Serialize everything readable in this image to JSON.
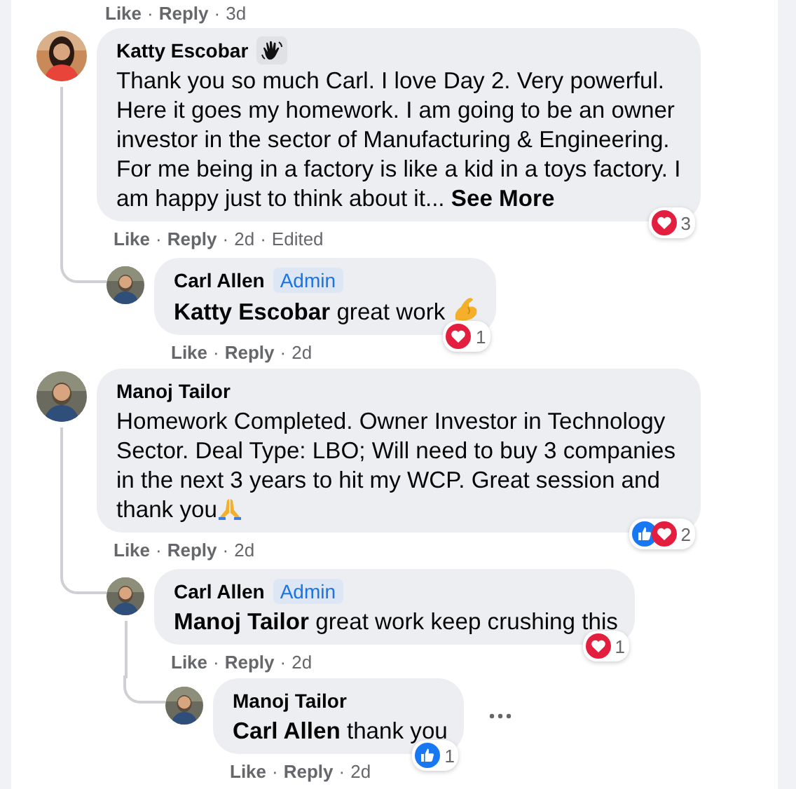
{
  "separator": "·",
  "previous_actions": {
    "like": "Like",
    "reply": "Reply",
    "time": "3d"
  },
  "comments": [
    {
      "author": "Katty Escobar",
      "featured": true,
      "avatar": {
        "kind": "picture"
      },
      "body": "Thank you so much Carl. I love Day 2. Very powerful. Here it goes my homework. I am going to be an owner investor in the sector of Manufacturing & Engineering. For me being in a factory is like a kid in a toys factory. I am happy just to think about it...",
      "see_more": "See More",
      "reactions": [
        {
          "kind": "love"
        }
      ],
      "reaction_count": "3",
      "actions": {
        "like": "Like",
        "reply": "Reply",
        "time": "2d",
        "edited": "Edited"
      },
      "children": [
        {
          "author": "Carl Allen",
          "badge": "Admin",
          "featured": false,
          "avatar": {
            "kind": "picture"
          },
          "body": "**Katty Escobar** great work",
          "emoji": {
            "kind": "flex"
          },
          "reactions": [
            {
              "kind": "love"
            }
          ],
          "reaction_count": "1",
          "actions": {
            "like": "Like",
            "reply": "Reply",
            "time": "2d"
          }
        }
      ]
    },
    {
      "author": "Manoj Tailor",
      "featured": false,
      "avatar": {
        "kind": "picture"
      },
      "body": "Homework Completed. Owner Investor in Technology Sector. Deal Type: LBO; Will need to buy 3 companies in the next 3 years to hit my WCP. Great session and thank you",
      "emoji": {
        "kind": "pray"
      },
      "reactions": [
        {
          "kind": "like"
        },
        {
          "kind": "love"
        }
      ],
      "reaction_count": "2",
      "actions": {
        "like": "Like",
        "reply": "Reply",
        "time": "2d"
      },
      "children": [
        {
          "author": "Carl Allen",
          "badge": "Admin",
          "featured": false,
          "avatar": {
            "kind": "picture"
          },
          "body": "**Manoj Tailor** great work keep crushing this",
          "reactions": [
            {
              "kind": "love"
            }
          ],
          "reaction_count": "1",
          "actions": {
            "like": "Like",
            "reply": "Reply",
            "time": "2d"
          },
          "children": [
            {
              "author": "Manoj Tailor",
              "featured": false,
              "avatar": {
                "kind": "picture"
              },
              "body": "**Carl Allen** thank you",
              "more_menu": true,
              "reactions": [
                {
                  "kind": "like"
                }
              ],
              "reaction_count": "1",
              "actions": {
                "like": "Like",
                "reply": "Reply",
                "time": "2d"
              }
            }
          ]
        }
      ]
    }
  ]
}
